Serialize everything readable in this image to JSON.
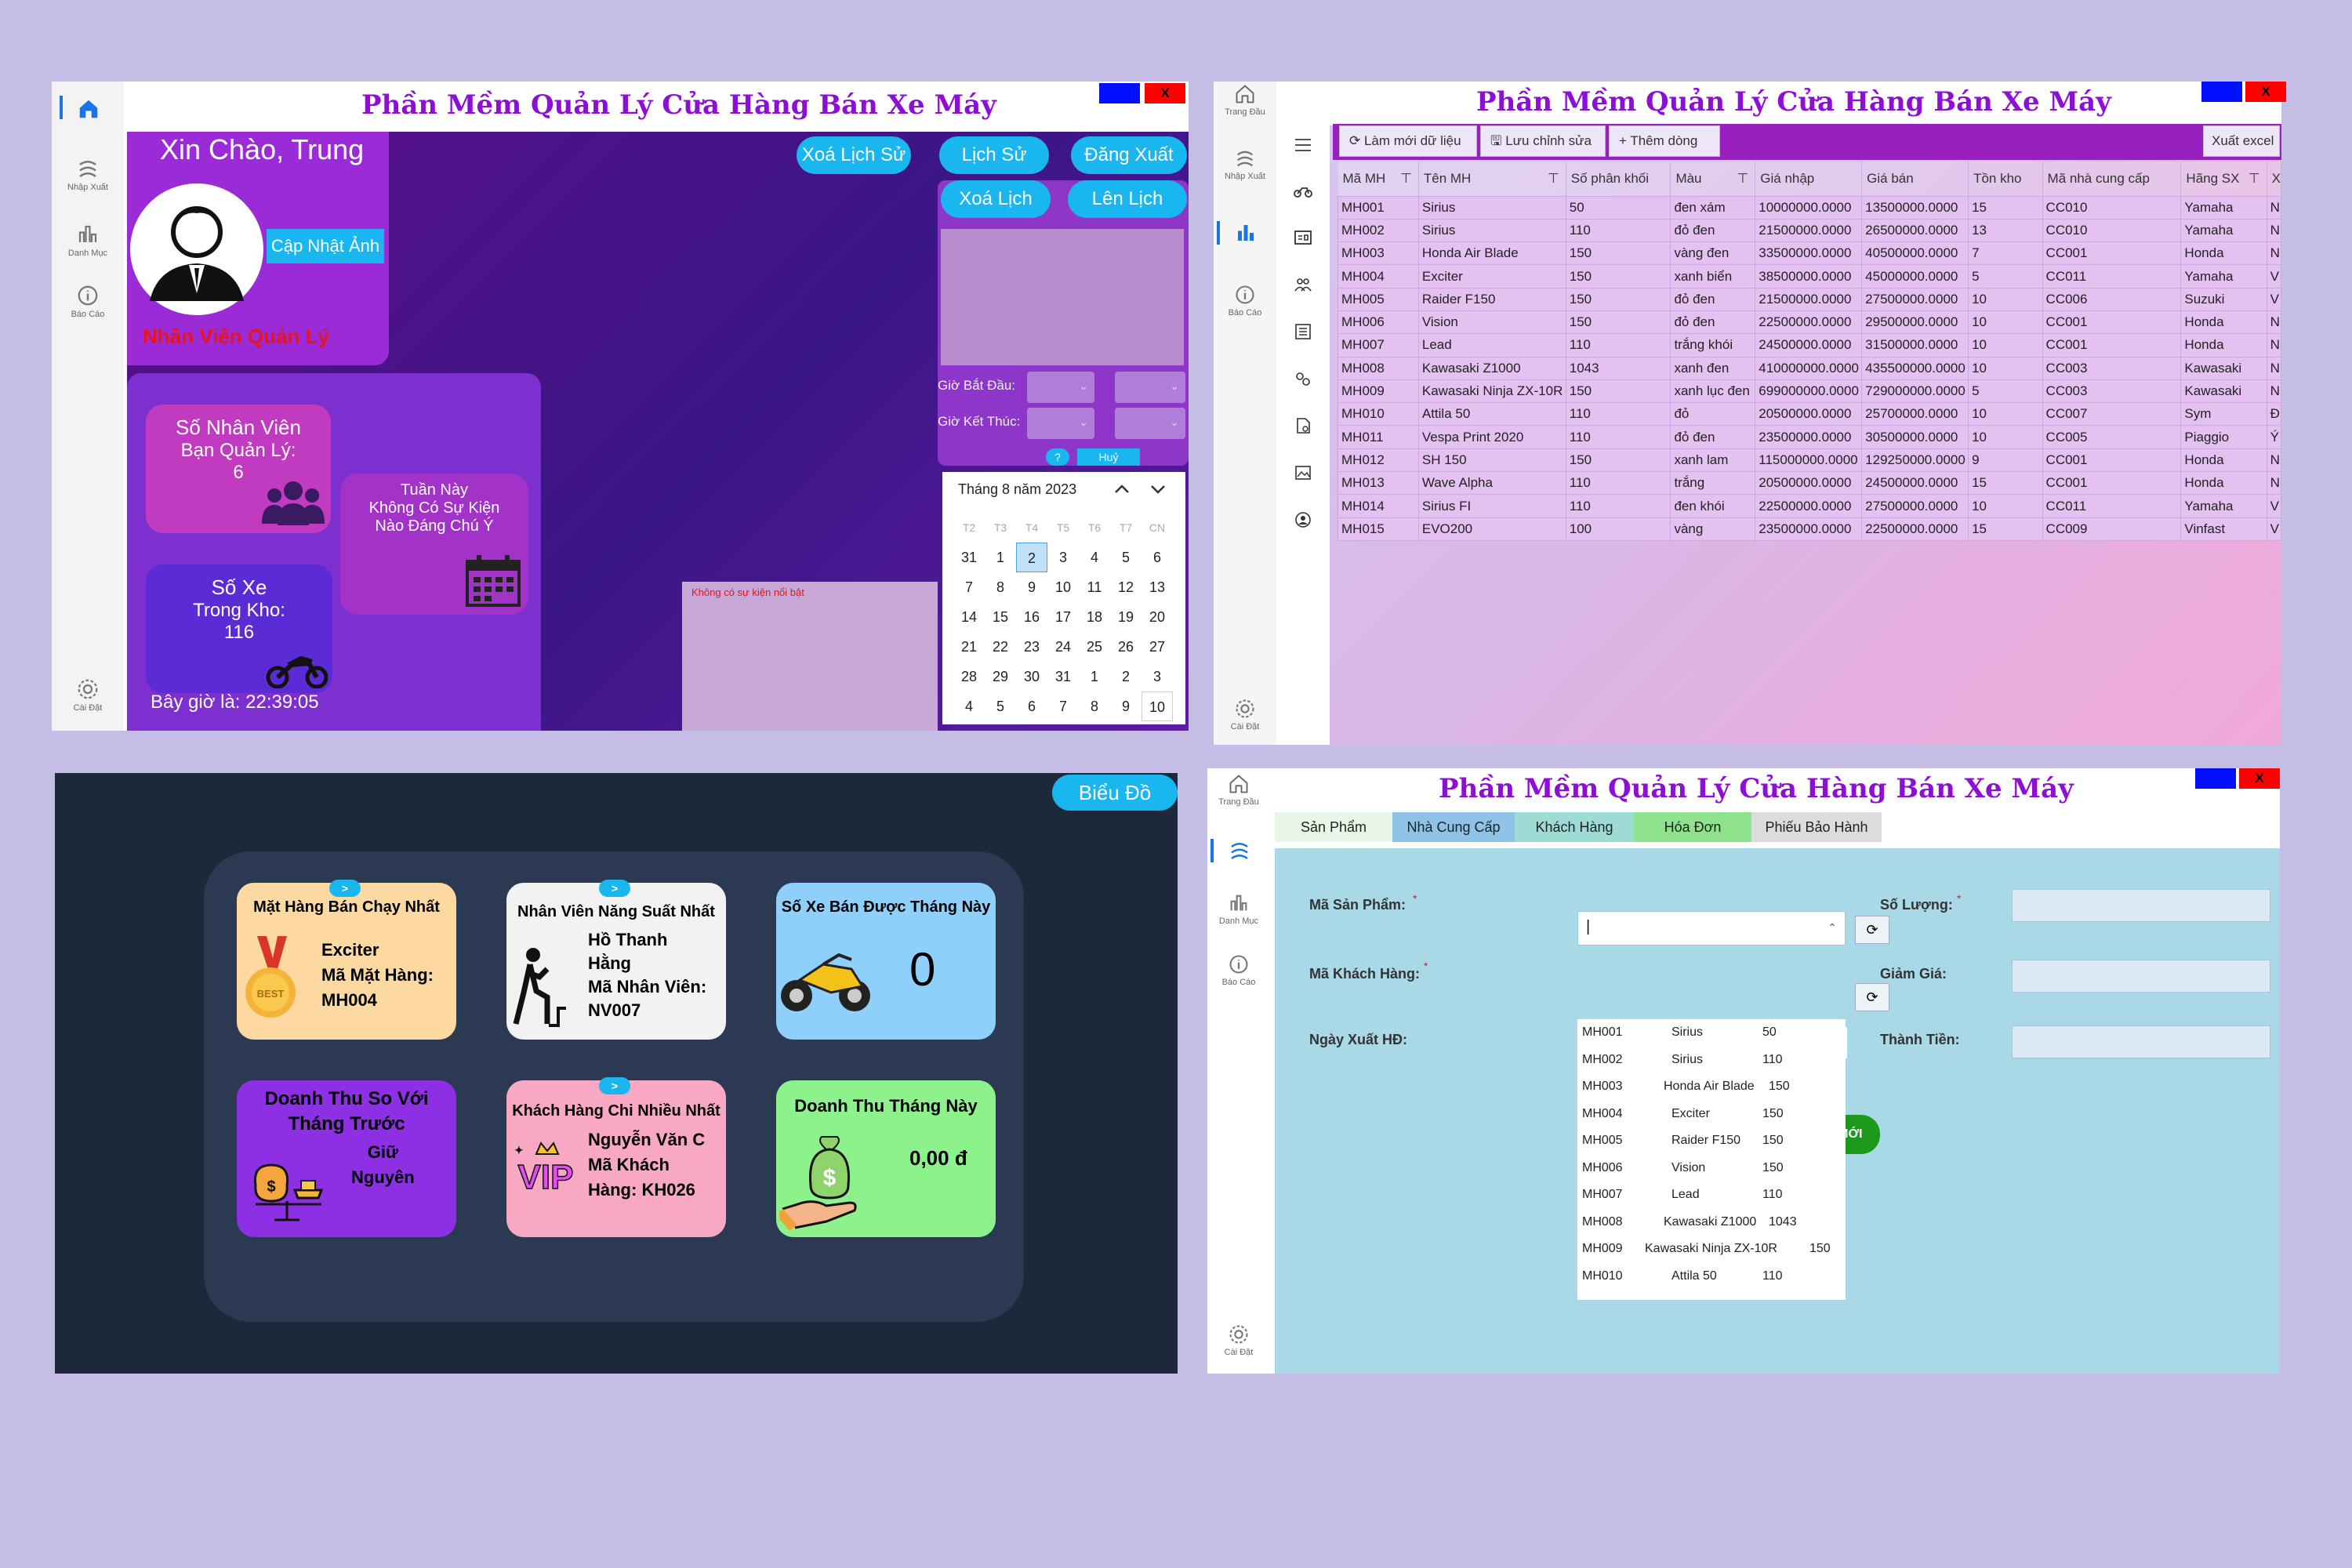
{
  "p1": {
    "title": "Phần Mềm Quản Lý Cửa Hàng Bán Xe Máy",
    "close": "X",
    "greeting": "Xin Chào, Trung",
    "update_photo": "Cập Nhật Ảnh",
    "role": "Nhân Viên Quản Lý",
    "buttons": [
      "Xoá Lịch Sử",
      "Lịch Sử",
      "Đăng Xuất",
      "Xoá Lịch",
      "Lên Lịch"
    ],
    "nav": [
      "Nhập Xuất",
      "Danh Mục",
      "Báo Cáo",
      "Cài Đặt"
    ],
    "staff_card": {
      "line1": "Số Nhân Viên",
      "line2": "Bạn Quản Lý:",
      "value": "6"
    },
    "week_card": {
      "line1": "Tuần Này",
      "line2": "Không Có Sự Kiện",
      "line3": "Nào Đáng Chú Ý"
    },
    "bikes_card": {
      "line1": "Số Xe",
      "line2": "Trong Kho:",
      "value": "116"
    },
    "clock": "Bây giờ là: 22:39:05",
    "start_label": "Giờ Bắt Đầu:",
    "end_label": "Giờ Kết Thúc:",
    "help": "?",
    "cancel": "Huỷ",
    "no_event": "Không có sự kiện nổi bật",
    "calendar": {
      "month": "Tháng 8 năm 2023",
      "weekdays": [
        "T2",
        "T3",
        "T4",
        "T5",
        "T6",
        "T7",
        "CN"
      ],
      "days": [
        "31",
        "1",
        "2",
        "3",
        "4",
        "5",
        "6",
        "7",
        "8",
        "9",
        "10",
        "11",
        "12",
        "13",
        "14",
        "15",
        "16",
        "17",
        "18",
        "19",
        "20",
        "21",
        "22",
        "23",
        "24",
        "25",
        "26",
        "27",
        "28",
        "29",
        "30",
        "31",
        "1",
        "2",
        "3",
        "4",
        "5",
        "6",
        "7",
        "8",
        "9",
        "10"
      ],
      "selected": "2"
    }
  },
  "p2": {
    "title": "Phần Mềm Quản Lý Cửa Hàng Bán Xe Máy",
    "close": "X",
    "nav": [
      "Trang Đầu",
      "Nhập Xuất",
      "Báo Cáo",
      "Cài Đặt"
    ],
    "toolbar": [
      "Làm mới dữ liệu",
      "Lưu chỉnh sửa",
      "Thêm dòng"
    ],
    "export": "Xuất excel",
    "columns": [
      "Mã MH",
      "Tên MH",
      "Số phân khối",
      "Màu",
      "Giá nhập",
      "Giá bán",
      "Tồn kho",
      "Mã nhà cung cấp",
      "Hãng SX",
      "X"
    ],
    "rows": [
      [
        "MH001",
        "Sirius",
        "50",
        "đen xám",
        "10000000.0000",
        "13500000.0000",
        "15",
        "CC010",
        "Yamaha",
        "N"
      ],
      [
        "MH002",
        "Sirius",
        "110",
        "đỏ đen",
        "21500000.0000",
        "26500000.0000",
        "13",
        "CC010",
        "Yamaha",
        "N"
      ],
      [
        "MH003",
        "Honda Air Blade",
        "150",
        "vàng đen",
        "33500000.0000",
        "40500000.0000",
        "7",
        "CC001",
        "Honda",
        "N"
      ],
      [
        "MH004",
        "Exciter",
        "150",
        "xanh biển",
        "38500000.0000",
        "45000000.0000",
        "5",
        "CC011",
        "Yamaha",
        "V"
      ],
      [
        "MH005",
        "Raider F150",
        "150",
        "đỏ đen",
        "21500000.0000",
        "27500000.0000",
        "10",
        "CC006",
        "Suzuki",
        "V"
      ],
      [
        "MH006",
        "Vision",
        "150",
        "đỏ đen",
        "22500000.0000",
        "29500000.0000",
        "10",
        "CC001",
        "Honda",
        "N"
      ],
      [
        "MH007",
        "Lead",
        "110",
        "trắng khói",
        "24500000.0000",
        "31500000.0000",
        "10",
        "CC001",
        "Honda",
        "N"
      ],
      [
        "MH008",
        "Kawasaki Z1000",
        "1043",
        "xanh đen",
        "410000000.0000",
        "435500000.0000",
        "10",
        "CC003",
        "Kawasaki",
        "N"
      ],
      [
        "MH009",
        "Kawasaki Ninja ZX-10R",
        "150",
        "xanh lục đen",
        "699000000.0000",
        "729000000.0000",
        "5",
        "CC003",
        "Kawasaki",
        "N"
      ],
      [
        "MH010",
        "Attila 50",
        "110",
        "đỏ",
        "20500000.0000",
        "25700000.0000",
        "10",
        "CC007",
        "Sym",
        "Đ"
      ],
      [
        "MH011",
        "Vespa Print 2020",
        "110",
        "đỏ đen",
        "23500000.0000",
        "30500000.0000",
        "10",
        "CC005",
        "Piaggio",
        "Ý"
      ],
      [
        "MH012",
        "SH 150",
        "150",
        "xanh lam",
        "115000000.0000",
        "129250000.0000",
        "9",
        "CC001",
        "Honda",
        "N"
      ],
      [
        "MH013",
        "Wave Alpha",
        "110",
        "trắng",
        "20500000.0000",
        "24500000.0000",
        "15",
        "CC001",
        "Honda",
        "N"
      ],
      [
        "MH014",
        "Sirius FI",
        "110",
        "đen khói",
        "22500000.0000",
        "27500000.0000",
        "10",
        "CC011",
        "Yamaha",
        "V"
      ],
      [
        "MH015",
        "EVO200",
        "100",
        "vàng",
        "23500000.0000",
        "22500000.0000",
        "15",
        "CC009",
        "Vinfast",
        "V"
      ]
    ]
  },
  "p3": {
    "chart_button": "Biểu Đồ",
    "arrow": ">",
    "best_product": {
      "title": "Mặt Hàng Bán Chạy Nhất",
      "name": "Exciter",
      "code_label": "Mã Mặt Hàng:",
      "code": "MH004",
      "icon_text": "BEST"
    },
    "best_staff": {
      "title": "Nhân Viên Năng Suất Nhất",
      "name1": "Hồ Thanh",
      "name2": "Hằng",
      "code_label": "Mã Nhân Viên:",
      "code": "NV007"
    },
    "bikes_month": {
      "title": "Số Xe Bán Được Tháng Này",
      "value": "0"
    },
    "revenue_compare": {
      "title1": "Doanh Thu So Với",
      "title2": "Tháng Trước",
      "status1": "Giữ",
      "status2": "Nguyên"
    },
    "top_customer": {
      "title": "Khách Hàng Chi Nhiều Nhất",
      "name": "Nguyễn Văn C",
      "code_label": "Mã Khách",
      "code_line": "Hàng: KH026",
      "icon_text": "VIP"
    },
    "revenue_month": {
      "title": "Doanh Thu Tháng Này",
      "value": "0,00 đ"
    }
  },
  "p4": {
    "title": "Phần Mềm Quản Lý Cửa Hàng Bán Xe Máy",
    "close": "X",
    "nav": [
      "Trang Đầu",
      "Danh Mục",
      "Báo Cáo",
      "Cài Đặt"
    ],
    "tabs": [
      "Sản Phẩm",
      "Nhà Cung Cấp",
      "Khách Hàng",
      "Hóa Đơn",
      "Phiếu Bảo Hành"
    ],
    "labels": {
      "product": "Mã Sản Phẩm:",
      "customer": "Mã Khách Hàng:",
      "date": "Ngày Xuất HĐ:",
      "qty": "Số Lượng:",
      "discount": "Giảm Giá:",
      "total": "Thành Tiền:"
    },
    "required": "*",
    "add_button": "THÊM MỚI",
    "dropdown": [
      [
        "MH001",
        "Sirius",
        "50"
      ],
      [
        "MH002",
        "Sirius",
        "110"
      ],
      [
        "MH003",
        "Honda Air Blade",
        "150"
      ],
      [
        "MH004",
        "Exciter",
        "150"
      ],
      [
        "MH005",
        "Raider F150",
        "150"
      ],
      [
        "MH006",
        "Vision",
        "150"
      ],
      [
        "MH007",
        "Lead",
        "110"
      ],
      [
        "MH008",
        "Kawasaki Z1000",
        "1043"
      ],
      [
        "MH009",
        "Kawasaki Ninja ZX-10R",
        "150"
      ],
      [
        "MH010",
        "Attila 50",
        "110"
      ]
    ]
  }
}
